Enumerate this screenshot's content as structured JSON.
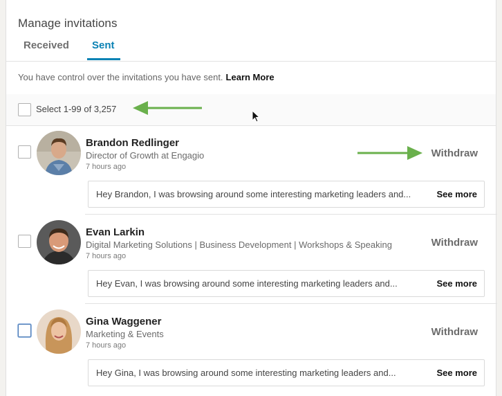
{
  "header": {
    "title": "Manage invitations"
  },
  "tabs": [
    {
      "label": "Received",
      "active": false
    },
    {
      "label": "Sent",
      "active": true
    }
  ],
  "info": {
    "text": "You have control over the invitations you have sent.",
    "link": "Learn More"
  },
  "selection": {
    "label": "Select 1-99 of 3,257"
  },
  "invitations": [
    {
      "name": "Brandon Redlinger",
      "headline": "Director of Growth at Engagio",
      "time": "7 hours ago",
      "action": "Withdraw",
      "message": "Hey Brandon, I was browsing around some interesting marketing leaders and...",
      "see_more": "See more"
    },
    {
      "name": "Evan Larkin",
      "headline": "Digital Marketing Solutions | Business Development | Workshops & Speaking",
      "time": "7 hours ago",
      "action": "Withdraw",
      "message": "Hey Evan, I was browsing around some interesting marketing leaders and...",
      "see_more": "See more"
    },
    {
      "name": "Gina Waggener",
      "headline": "Marketing & Events",
      "time": "7 hours ago",
      "action": "Withdraw",
      "message": "Hey Gina, I was browsing around some interesting marketing leaders and...",
      "see_more": "See more"
    }
  ],
  "colors": {
    "accent": "#0a82b4",
    "annotation_arrow": "#6ab04c"
  }
}
